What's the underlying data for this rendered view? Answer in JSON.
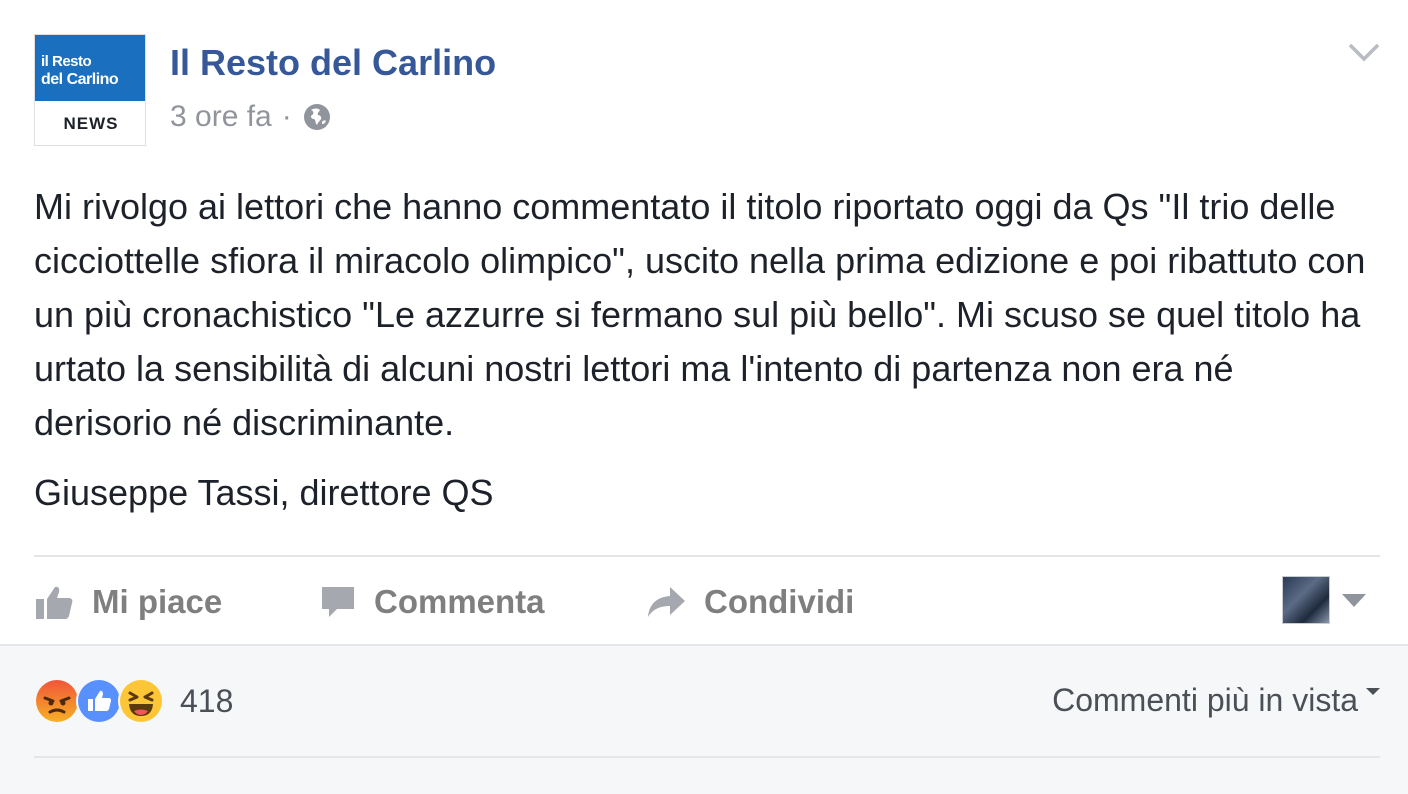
{
  "post": {
    "avatar": {
      "logo_line1": "il Resto",
      "logo_line2": "del Carlino",
      "logo_tag": "NEWS"
    },
    "page_name": "Il Resto del Carlino",
    "timestamp": "3 ore fa",
    "separator": "·",
    "audience_icon": "globe-icon",
    "options_icon": "chevron-down-icon",
    "body": {
      "paragraph": "Mi rivolgo ai lettori che hanno commentato il titolo riportato oggi da Qs \"Il trio delle cicciottelle sfiora il miracolo olimpico\", uscito nella prima edizione e poi ribattuto con un più cronachistico \"Le azzurre si fermano sul più bello\". Mi scuso se quel titolo ha urtato la sensibilità di alcuni nostri lettori ma l'intento di partenza non era né derisorio né discriminante.",
      "signature": "Giuseppe Tassi, direttore QS"
    }
  },
  "actions": {
    "like": {
      "label": "Mi piace",
      "icon": "thumbs-up-icon"
    },
    "comment": {
      "label": "Commenta",
      "icon": "comment-icon"
    },
    "share": {
      "label": "Condividi",
      "icon": "share-arrow-icon"
    }
  },
  "footer": {
    "reactions": [
      "angry-reaction-icon",
      "like-reaction-icon",
      "haha-reaction-icon"
    ],
    "reaction_count": "418",
    "sort_label": "Commenti più in vista"
  },
  "colors": {
    "link_blue": "#365899",
    "muted_gray": "#90949c",
    "action_gray": "#7f7f7f",
    "footer_bg": "#f6f7f9",
    "like_blue": "#5890ff",
    "angry_orange": "#e9710f",
    "haha_yellow": "#fcc636"
  }
}
